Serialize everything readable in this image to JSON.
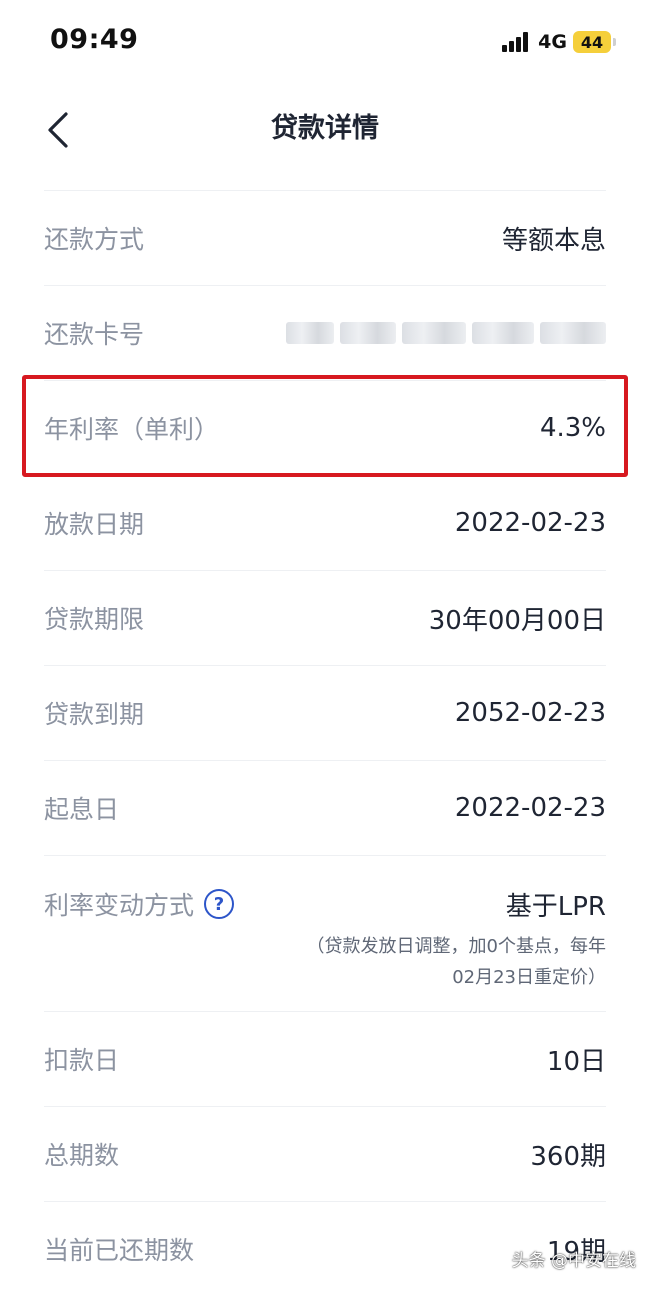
{
  "status_bar": {
    "time": "09:49",
    "network": "4G",
    "battery": "44",
    "battery_color": "#f5cf3b"
  },
  "header": {
    "back_icon": "chevron-left-icon",
    "title": "贷款详情"
  },
  "rows": [
    {
      "label": "还款方式",
      "value": "等额本息"
    },
    {
      "label": "还款卡号",
      "value": ""
    },
    {
      "label": "年利率（单利）",
      "value": "4.3%"
    },
    {
      "label": "放款日期",
      "value": "2022-02-23"
    },
    {
      "label": "贷款期限",
      "value": "30年00月00日"
    },
    {
      "label": "贷款到期",
      "value": "2052-02-23"
    },
    {
      "label": "起息日",
      "value": "2022-02-23"
    },
    {
      "label": "利率变动方式",
      "value": "基于LPR",
      "note": "（贷款发放日调整，加0个基点，每年02月23日重定价）"
    },
    {
      "label": "扣款日",
      "value": "10日"
    },
    {
      "label": "总期数",
      "value": "360期"
    },
    {
      "label": "当前已还期数",
      "value": "19期"
    }
  ],
  "help_icon": {
    "glyph": "?",
    "icon": "question-circle-icon",
    "color": "#2d55c9"
  },
  "highlight_color": "#d71920",
  "watermark": "头条 @中安在线"
}
